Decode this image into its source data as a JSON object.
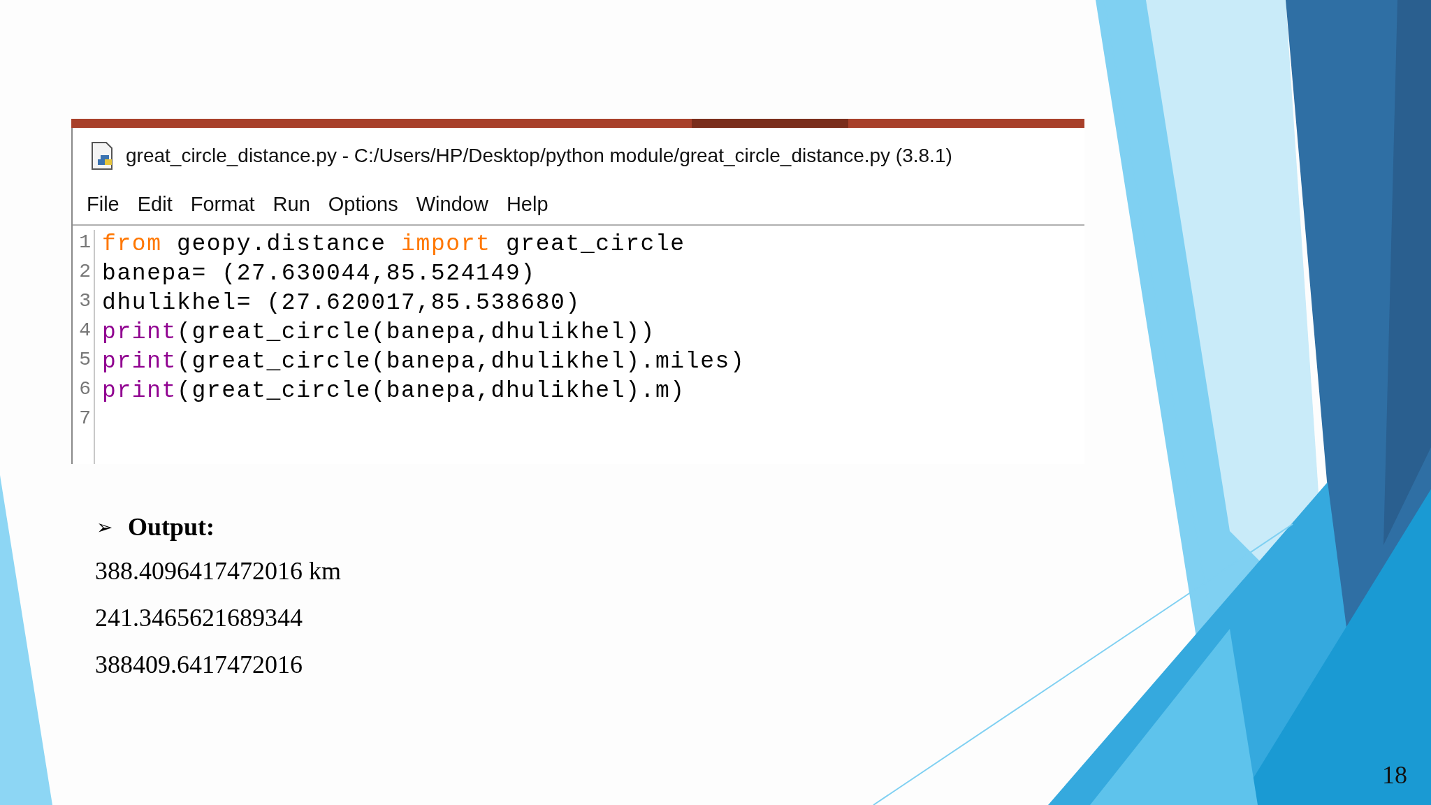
{
  "window": {
    "title": "great_circle_distance.py - C:/Users/HP/Desktop/python module/great_circle_distance.py (3.8.1)"
  },
  "menu": [
    "File",
    "Edit",
    "Format",
    "Run",
    "Options",
    "Window",
    "Help"
  ],
  "code": [
    {
      "number": "1",
      "tokens": [
        {
          "text": "from",
          "kind": "keyword"
        },
        {
          "text": " geopy.distance ",
          "kind": "plain"
        },
        {
          "text": "import",
          "kind": "keyword"
        },
        {
          "text": " great_circle",
          "kind": "plain"
        }
      ]
    },
    {
      "number": "2",
      "tokens": [
        {
          "text": "banepa= (27.630044,85.524149)",
          "kind": "plain"
        }
      ]
    },
    {
      "number": "3",
      "tokens": [
        {
          "text": "dhulikhel= (27.620017,85.538680)",
          "kind": "plain"
        }
      ]
    },
    {
      "number": "4",
      "tokens": [
        {
          "text": "print",
          "kind": "builtin"
        },
        {
          "text": "(great_circle(banepa,dhulikhel))",
          "kind": "plain"
        }
      ]
    },
    {
      "number": "5",
      "tokens": [
        {
          "text": "print",
          "kind": "builtin"
        },
        {
          "text": "(great_circle(banepa,dhulikhel).miles)",
          "kind": "plain"
        }
      ]
    },
    {
      "number": "6",
      "tokens": [
        {
          "text": "print",
          "kind": "builtin"
        },
        {
          "text": "(great_circle(banepa,dhulikhel).m)",
          "kind": "plain"
        }
      ]
    },
    {
      "number": "7"
    }
  ],
  "output": {
    "bullet": "➢",
    "label": "Output:",
    "lines": [
      "388.4096417472016 km",
      "241.3465621689344",
      "388409.6417472016"
    ]
  },
  "page_number": "18"
}
